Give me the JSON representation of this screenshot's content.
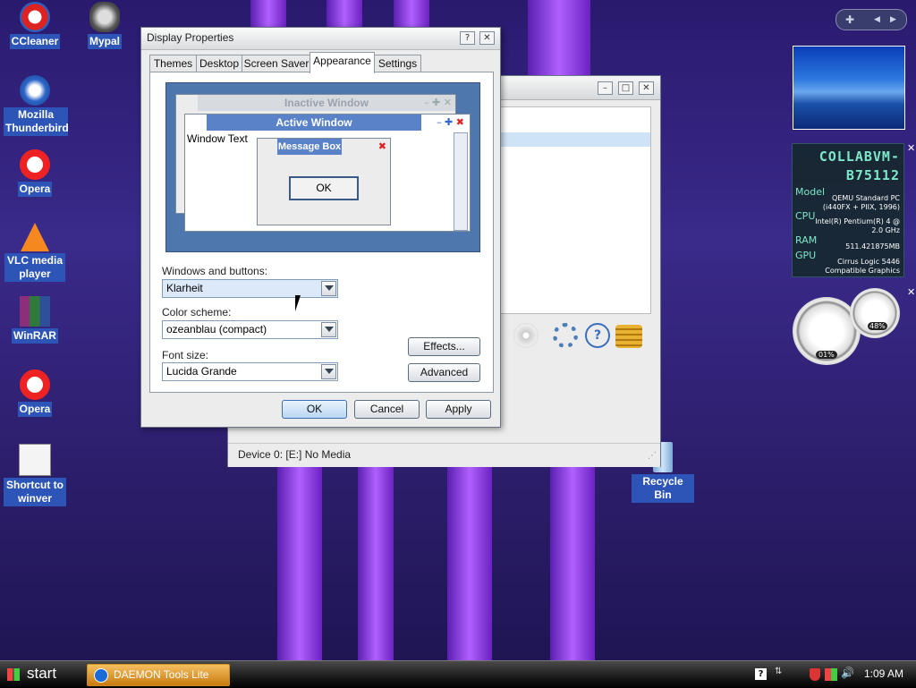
{
  "desktop_icons": [
    {
      "label": "CCleaner"
    },
    {
      "label": "Mypal"
    },
    {
      "label": "Mozilla Thunderbird"
    },
    {
      "label": "Opera"
    },
    {
      "label": "VLC media player"
    },
    {
      "label": "WinRAR"
    },
    {
      "label": "Opera"
    },
    {
      "label": "Shortcut to winver"
    },
    {
      "label": "Recycle Bin"
    }
  ],
  "dialog": {
    "title": "Display Properties",
    "help_glyph": "?",
    "close_glyph": "✕",
    "tabs": [
      {
        "label": "Themes"
      },
      {
        "label": "Desktop"
      },
      {
        "label": "Screen Saver"
      },
      {
        "label": "Appearance"
      },
      {
        "label": "Settings"
      }
    ],
    "active_tab": "Appearance",
    "preview": {
      "inactive_title": "Inactive Window",
      "active_title": "Active Window",
      "window_text": "Window Text",
      "message_title": "Message Box",
      "ok": "OK"
    },
    "windows_buttons_label": "Windows and buttons:",
    "windows_buttons_value": "Klarheit",
    "color_scheme_label": "Color scheme:",
    "color_scheme_value": "ozeanblau (compact)",
    "font_size_label": "Font size:",
    "font_size_value": "Lucida Grande",
    "effects_btn": "Effects...",
    "advanced_btn": "Advanced",
    "ok_btn": "OK",
    "cancel_btn": "Cancel",
    "apply_btn": "Apply"
  },
  "bg_window": {
    "status": "Device 0: [E:] No Media"
  },
  "gadget_sysinfo": {
    "name": "COLLABVM-B75112",
    "model_label": "Model",
    "model_value": "QEMU Standard PC (i440FX + PIIX, 1996)",
    "cpu_label": "CPU",
    "cpu_value": "Intel(R) Pentium(R) 4 @ 2.0 GHz",
    "ram_label": "RAM",
    "ram_value": "511.421875MB",
    "gpu_label": "GPU",
    "gpu_value": "Cirrus Logic 5446 Compatible Graphics"
  },
  "gadget_meter": {
    "cpu": "01%",
    "mem": "48%"
  },
  "taskbar": {
    "start": "start",
    "task": "DAEMON Tools Lite",
    "clock": "1:09 AM"
  },
  "colors": {
    "accent": "#3b6fb6",
    "active_title": "#5a82c8",
    "desktop": "#2a1a6e"
  }
}
